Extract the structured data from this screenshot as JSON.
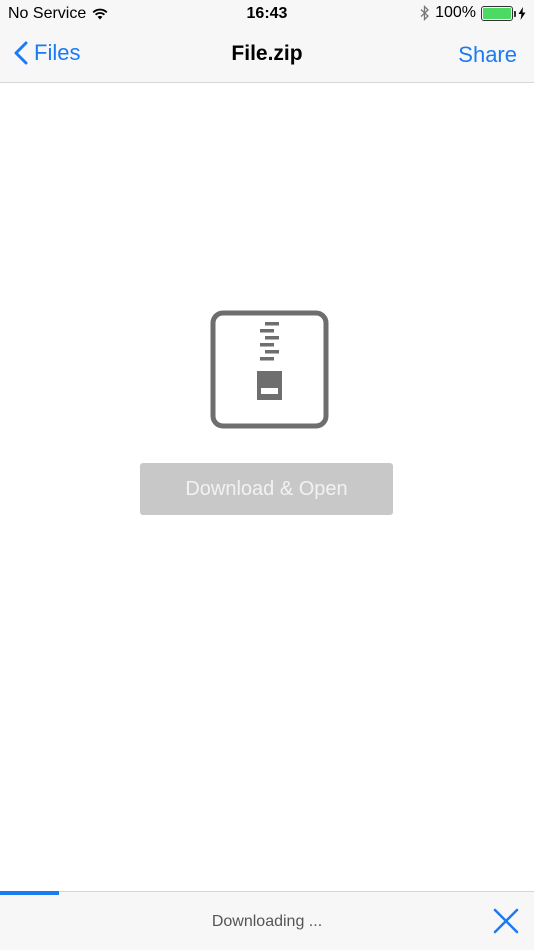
{
  "status_bar": {
    "carrier": "No Service",
    "time": "16:43",
    "battery_percent": "100%",
    "battery_level": 1.0,
    "icons": [
      "wifi-icon",
      "bluetooth-icon",
      "battery-icon",
      "charging-bolt-icon"
    ]
  },
  "nav": {
    "back_label": "Files",
    "title": "File.zip",
    "share_label": "Share",
    "accent_color": "#1a7bf2"
  },
  "main": {
    "file_icon": "zip-archive-icon",
    "download_button_label": "Download & Open",
    "download_button_color": "#c8c8c8"
  },
  "bottom": {
    "status_text": "Downloading ...",
    "progress": 0.11,
    "cancel_icon": "close-icon"
  }
}
